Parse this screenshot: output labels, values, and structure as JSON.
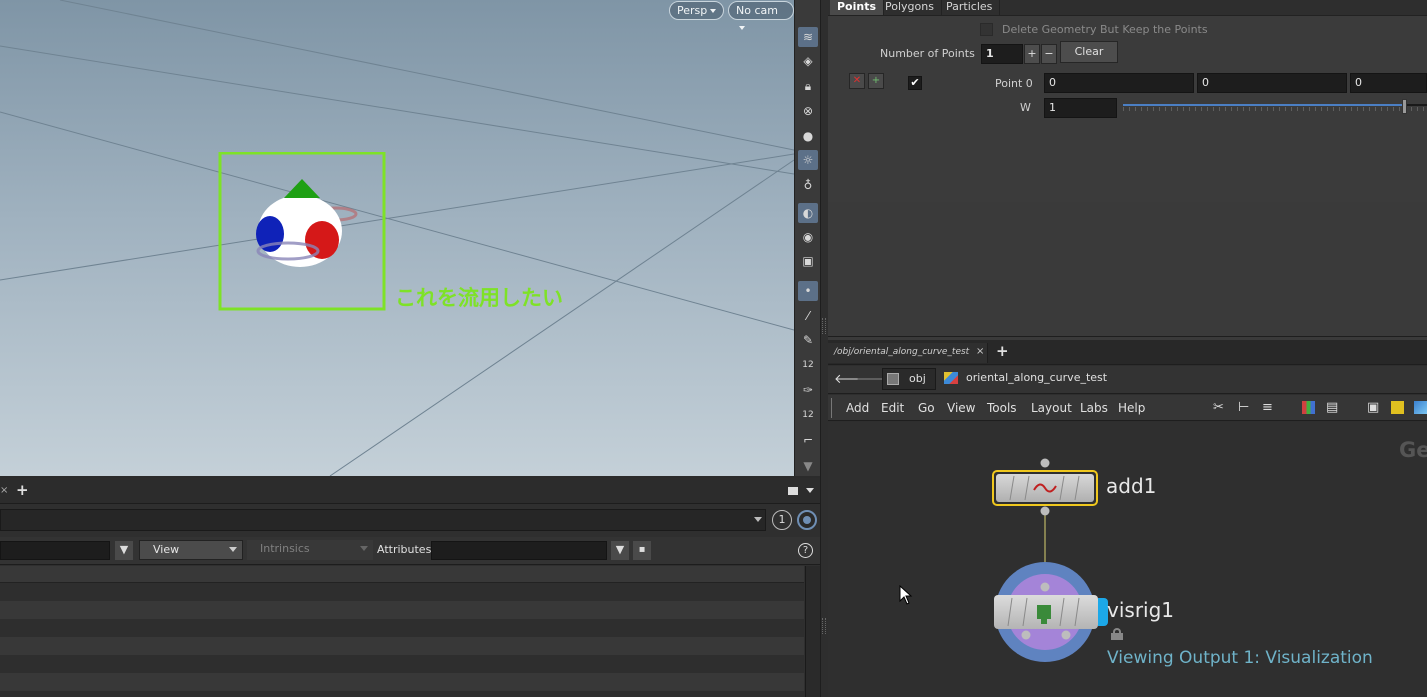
{
  "viewport": {
    "camera_menu": "Persp",
    "cam_menu": "No cam",
    "annotation_text": "これを流用したい",
    "annotation_color": "#7ee227"
  },
  "viewport_toolbar": {
    "icons": [
      "display-options-icon",
      "wireframe-icon",
      "lock-icon",
      "close-circle-icon",
      "sphere-icon",
      "light-icon",
      "bulb-icon",
      "shading-icon",
      "eye-icon",
      "render-icon",
      "point-icon",
      "brush-icon",
      "pen-icon",
      "number-icon",
      "paint-icon",
      "number-icon-2",
      "angle-icon",
      "down-arrow-icon"
    ],
    "numbers": [
      "12",
      "12"
    ]
  },
  "spreadsheet": {
    "add_tab_symbol": "+",
    "view_label": "View",
    "intrinsics_label": "Intrinsics",
    "attributes_label": "Attributes:",
    "badge_number": "1",
    "help_symbol": "?"
  },
  "params": {
    "tabs": [
      {
        "label": "Points",
        "active": true
      },
      {
        "label": "Polygons",
        "active": false
      },
      {
        "label": "Particles",
        "active": false
      }
    ],
    "delete_geometry_label": "Delete Geometry But Keep the Points",
    "number_of_points_label": "Number of Points",
    "number_of_points_value": "1",
    "plus_label": "+",
    "minus_label": "−",
    "clear_label": "Clear",
    "point0_label": "Point 0",
    "point0_values": [
      "0",
      "0",
      "0"
    ],
    "w_label": "W",
    "w_value": "1",
    "w_slider_fraction": 0.95
  },
  "network": {
    "tab_path": "/obj/oriental_along_curve_test",
    "tab_close": "×",
    "add_tab": "+",
    "breadcrumb": [
      "obj",
      "oriental_along_curve_test"
    ],
    "menu": [
      "Add",
      "Edit",
      "Go",
      "View",
      "Tools",
      "Layout",
      "Labs",
      "Help"
    ],
    "context_label": "Ge",
    "nodes": {
      "add": "add1",
      "visrig": "visrig1"
    },
    "viewing_output": "Viewing Output 1: Visualization"
  }
}
